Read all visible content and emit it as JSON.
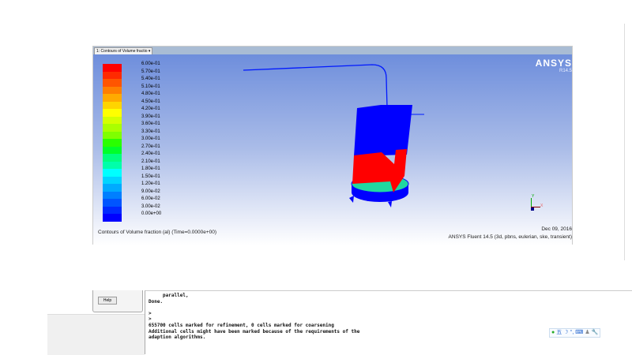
{
  "graphics": {
    "window_selector": "1: Contours of Volume fractio",
    "logo": "ANSYS",
    "version": "R14.5",
    "caption": "Contours of Volume fraction (al)   (Time=0.0000e+00)",
    "date": "Dec 09, 2016",
    "info": "ANSYS Fluent 14.5 (3d, pbns, eulerian, ske, transient)"
  },
  "legend": {
    "labels": [
      "6.00e-01",
      "5.70e-01",
      "5.40e-01",
      "5.10e-01",
      "4.80e-01",
      "4.50e-01",
      "4.20e-01",
      "3.90e-01",
      "3.60e-01",
      "3.30e-01",
      "3.00e-01",
      "2.70e-01",
      "2.40e-01",
      "2.10e-01",
      "1.80e-01",
      "1.50e-01",
      "1.20e-01",
      "9.00e-02",
      "6.00e-02",
      "3.00e-02",
      "0.00e+00"
    ],
    "colors": [
      "#ff0000",
      "#ff2a00",
      "#ff5500",
      "#ff7f00",
      "#ffaa00",
      "#ffd400",
      "#ffff00",
      "#d4ff00",
      "#aaff00",
      "#7fff00",
      "#2aff00",
      "#00ff2a",
      "#00ff7f",
      "#00ffaa",
      "#00ffff",
      "#00d4ff",
      "#00aaff",
      "#007fff",
      "#0055ff",
      "#002aff",
      "#0000ff"
    ]
  },
  "dialog": {
    "help_label": "Help"
  },
  "console": {
    "lines": [
      "     parallel,",
      "Done.",
      "",
      ">",
      ">",
      "655700 cells marked for refinement, 0 cells marked for coarsening",
      "Additional cells might have been marked because of the requirements of the",
      "adaption algorithms."
    ]
  },
  "axes": {
    "x": "X",
    "y": "Y"
  }
}
